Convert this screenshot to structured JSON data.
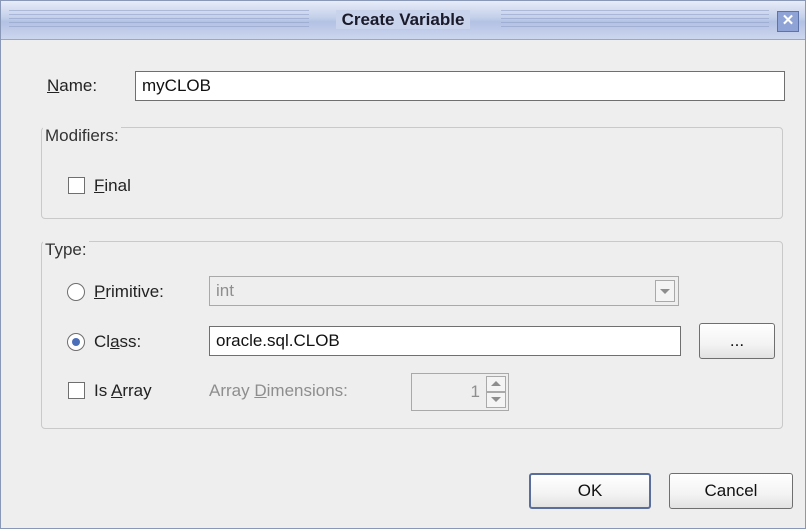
{
  "window": {
    "title": "Create Variable",
    "close_glyph": "✕"
  },
  "name_field": {
    "label_mnemonic": "N",
    "label_rest": "ame:",
    "value": "myCLOB"
  },
  "modifiers": {
    "title": "Modifiers:",
    "final": {
      "checked": false,
      "label_mnemonic": "F",
      "label_rest": "inal"
    }
  },
  "type": {
    "title": "Type:",
    "primitive": {
      "selected": false,
      "label_mnemonic": "P",
      "label_rest": "rimitive:",
      "value": "int",
      "enabled": false
    },
    "class": {
      "selected": true,
      "label_before": "Cl",
      "label_mnemonic": "a",
      "label_rest": "ss:",
      "value": "oracle.sql.CLOB",
      "browse_label": "..."
    },
    "is_array": {
      "checked": false,
      "label_before": "Is ",
      "label_mnemonic": "A",
      "label_rest": "rray"
    },
    "array_dimensions": {
      "label_before": "Array ",
      "label_mnemonic": "D",
      "label_rest": "imensions:",
      "value": "1",
      "enabled": false
    }
  },
  "buttons": {
    "ok": "OK",
    "cancel": "Cancel"
  },
  "colors": {
    "titlebar": "#c2cee9",
    "dialog_bg": "#eeeeee",
    "radio_dot": "#4b6fb8",
    "disabled_text": "#8e8e8e"
  }
}
